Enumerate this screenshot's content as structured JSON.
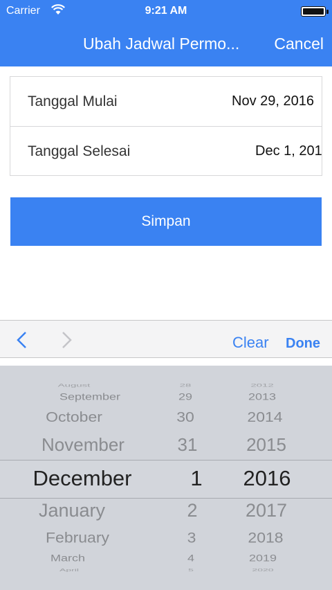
{
  "status_bar": {
    "carrier": "Carrier",
    "time": "9:21 AM"
  },
  "nav": {
    "title": "Ubah Jadwal Permo...",
    "cancel": "Cancel"
  },
  "form": {
    "start_label": "Tanggal Mulai",
    "start_value": "Nov 29, 2016",
    "end_label": "Tanggal Selesai",
    "end_value": "Dec 1, 201"
  },
  "save_label": "Simpan",
  "toolbar": {
    "clear": "Clear",
    "done": "Done"
  },
  "picker": {
    "months": [
      "August",
      "September",
      "October",
      "November",
      "December",
      "January",
      "February",
      "March",
      "April"
    ],
    "days": [
      "28",
      "29",
      "30",
      "31",
      "1",
      "2",
      "3",
      "4",
      "5"
    ],
    "years": [
      "2012",
      "2013",
      "2014",
      "2015",
      "2016",
      "2017",
      "2018",
      "2019",
      "2020"
    ],
    "selected": {
      "month": "December",
      "day": "1",
      "year": "2016"
    }
  },
  "colors": {
    "accent": "#3a82f2",
    "picker_bg": "#d1d4da"
  }
}
